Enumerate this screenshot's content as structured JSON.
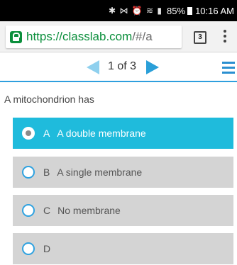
{
  "status_bar": {
    "icons": "✱ ⋈ ⏰ ≋ ▮",
    "battery": "85%",
    "time": "10:16 AM"
  },
  "browser": {
    "url_scheme": "https://",
    "url_host": "classlab.com",
    "url_rest": "/#/a",
    "tab_count": "3"
  },
  "pager": {
    "indicator": "1 of 3"
  },
  "question": {
    "text": "A mitochondrion has"
  },
  "options": [
    {
      "letter": "A",
      "text": "A double membrane",
      "selected": true
    },
    {
      "letter": "B",
      "text": "A single membrane",
      "selected": false
    },
    {
      "letter": "C",
      "text": "No membrane",
      "selected": false
    },
    {
      "letter": "D",
      "text": "",
      "selected": false
    }
  ],
  "colors": {
    "selected_option": "#1fbbdc",
    "option": "#d4d4d4",
    "accent": "#2a9fd8",
    "secure": "#0b8f3c"
  }
}
